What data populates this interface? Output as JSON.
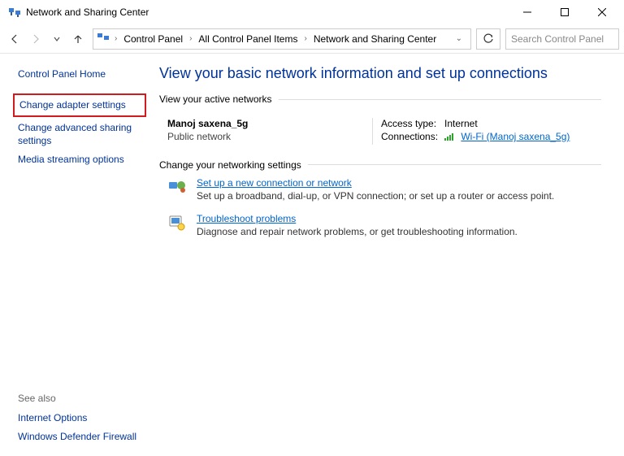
{
  "window": {
    "title": "Network and Sharing Center"
  },
  "breadcrumb": {
    "items": [
      "Control Panel",
      "All Control Panel Items",
      "Network and Sharing Center"
    ]
  },
  "search": {
    "placeholder": "Search Control Panel"
  },
  "sidebar": {
    "home": "Control Panel Home",
    "links": [
      "Change adapter settings",
      "Change advanced sharing settings",
      "Media streaming options"
    ],
    "see_also_label": "See also",
    "see_also": [
      "Internet Options",
      "Windows Defender Firewall"
    ]
  },
  "main": {
    "heading": "View your basic network information and set up connections",
    "active_label": "View your active networks",
    "network": {
      "name": "Manoj saxena_5g",
      "type": "Public network",
      "access_label": "Access type:",
      "access_value": "Internet",
      "conn_label": "Connections:",
      "conn_value": "Wi-Fi (Manoj saxena_5g)"
    },
    "change_label": "Change your networking settings",
    "items": [
      {
        "title": "Set up a new connection or network",
        "desc": "Set up a broadband, dial-up, or VPN connection; or set up a router or access point."
      },
      {
        "title": "Troubleshoot problems",
        "desc": "Diagnose and repair network problems, or get troubleshooting information."
      }
    ]
  }
}
